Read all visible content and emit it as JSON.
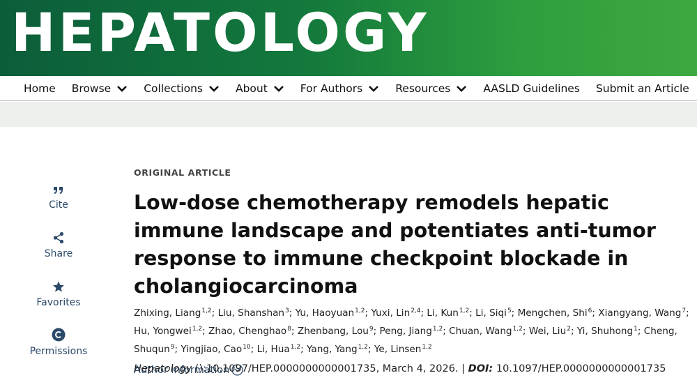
{
  "journal": {
    "title": "HEPATOLOGY"
  },
  "nav": {
    "items": [
      {
        "label": "Home",
        "has_dropdown": false
      },
      {
        "label": "Browse",
        "has_dropdown": true
      },
      {
        "label": "Collections",
        "has_dropdown": true
      },
      {
        "label": "About",
        "has_dropdown": true
      },
      {
        "label": "For Authors",
        "has_dropdown": true
      },
      {
        "label": "Resources",
        "has_dropdown": true
      },
      {
        "label": "AASLD Guidelines",
        "has_dropdown": false
      },
      {
        "label": "Submit an Article",
        "has_dropdown": false
      }
    ]
  },
  "sidebar": {
    "items": [
      {
        "label": "Cite",
        "icon": "quote-icon"
      },
      {
        "label": "Share",
        "icon": "share-icon"
      },
      {
        "label": "Favorites",
        "icon": "star-icon"
      },
      {
        "label": "Permissions",
        "icon": "copyright-icon"
      }
    ]
  },
  "article": {
    "type": "ORIGINAL ARTICLE",
    "title": "Low-dose chemotherapy remodels hepatic immune landscape and potentiates anti-tumor response to immune checkpoint blockade in cholangiocarcinoma",
    "authors": [
      {
        "name": "Zhixing, Liang",
        "aff": "1,2"
      },
      {
        "name": "Liu, Shanshan",
        "aff": "3"
      },
      {
        "name": "Yu, Haoyuan",
        "aff": "1,2"
      },
      {
        "name": "Yuxi, Lin",
        "aff": "2,4"
      },
      {
        "name": "Li, Kun",
        "aff": "1,2"
      },
      {
        "name": "Li, Siqi",
        "aff": "5"
      },
      {
        "name": "Mengchen, Shi",
        "aff": "6"
      },
      {
        "name": "Xiangyang, Wang",
        "aff": "7"
      },
      {
        "name": "Hu, Yongwei",
        "aff": "1,2"
      },
      {
        "name": "Zhao, Chenghao",
        "aff": "8"
      },
      {
        "name": "Zhenbang, Lou",
        "aff": "9"
      },
      {
        "name": "Peng, Jiang",
        "aff": "1,2"
      },
      {
        "name": "Chuan, Wang",
        "aff": "1,2"
      },
      {
        "name": "Wei, Liu",
        "aff": "2"
      },
      {
        "name": "Yi, Shuhong",
        "aff": "1"
      },
      {
        "name": "Cheng, Shuqun",
        "aff": "9"
      },
      {
        "name": "Yingjiao, Cao",
        "aff": "10"
      },
      {
        "name": "Li, Hua",
        "aff": "1,2"
      },
      {
        "name": "Yang, Yang",
        "aff": "1,2"
      },
      {
        "name": "Ye, Linsen",
        "aff": "1,2"
      }
    ],
    "author_info_label": "Author Information",
    "citation": {
      "journal": "Hepatology",
      "details": " ():10.1097/HEP.0000000000001735, March 4, 2026. | ",
      "doi_label": "DOI:",
      "doi": " 10.1097/HEP.0000000000001735"
    }
  },
  "colors": {
    "banner_start": "#0b5d3a",
    "banner_end": "#3ea840",
    "link": "#2b4a6a",
    "divider_bar": "#eef0ee"
  }
}
